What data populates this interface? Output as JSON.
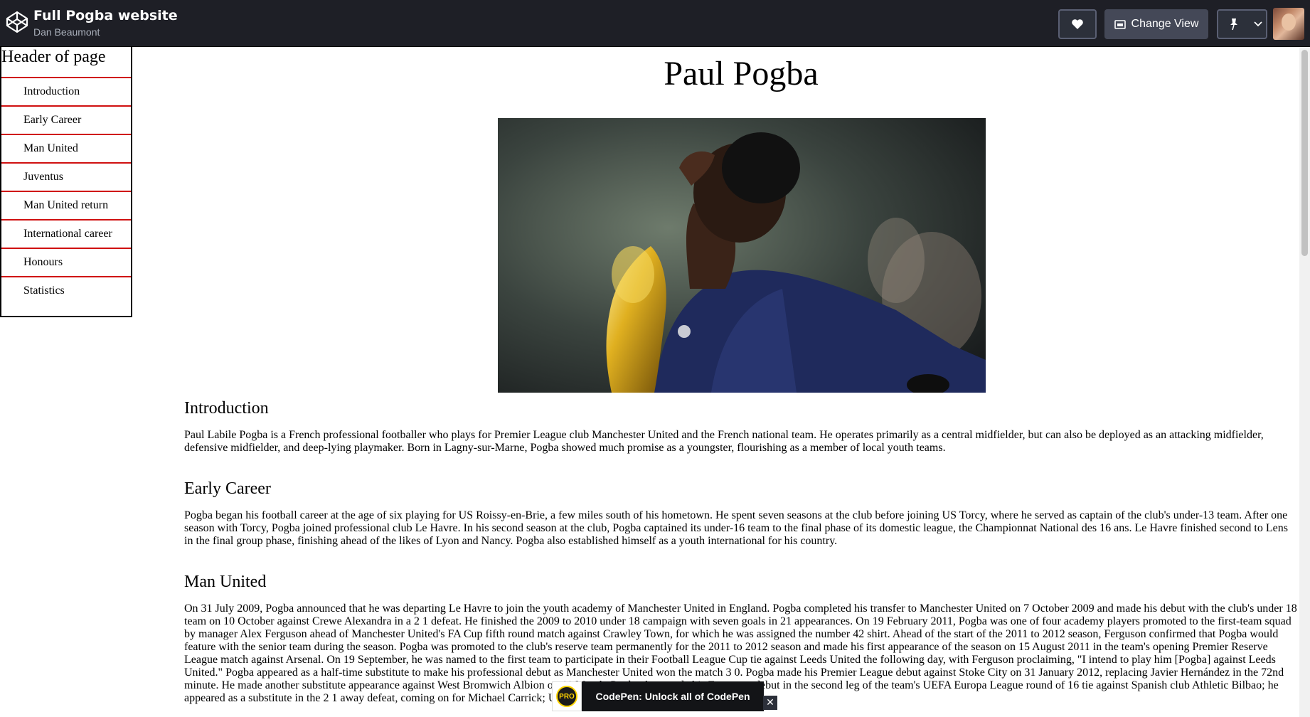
{
  "topbar": {
    "pen_title": "Full Pogba website",
    "author": "Dan Beaumont",
    "change_view_label": "Change View",
    "bg_color": "#1e1f26"
  },
  "nav": {
    "header": "Header of page",
    "items": [
      {
        "label": "Introduction"
      },
      {
        "label": "Early Career"
      },
      {
        "label": "Man United"
      },
      {
        "label": "Juventus"
      },
      {
        "label": "Man United return"
      },
      {
        "label": "International career"
      },
      {
        "label": "Honours"
      },
      {
        "label": "Statistics"
      }
    ],
    "divider_color": "#d01010"
  },
  "main": {
    "title": "Paul Pogba",
    "sections": [
      {
        "heading": "Introduction",
        "body": "Paul Labile Pogba is a French professional footballer who plays for Premier League club Manchester United and the French national team. He operates primarily as a central midfielder, but can also be deployed as an attacking midfielder, defensive midfielder, and deep-lying playmaker. Born in Lagny-sur-Marne, Pogba showed much promise as a youngster, flourishing as a member of local youth teams."
      },
      {
        "heading": "Early Career",
        "body": "Pogba began his football career at the age of six playing for US Roissy-en-Brie, a few miles south of his hometown. He spent seven seasons at the club before joining US Torcy, where he served as captain of the club's under-13 team. After one season with Torcy, Pogba joined professional club Le Havre. In his second season at the club, Pogba captained its under-16 team to the final phase of its domestic league, the Championnat National des 16 ans. Le Havre finished second to Lens in the final group phase, finishing ahead of the likes of Lyon and Nancy. Pogba also established himself as a youth international for his country."
      },
      {
        "heading": "Man United",
        "body": "On 31 July 2009, Pogba announced that he was departing Le Havre to join the youth academy of Manchester United in England. Pogba completed his transfer to Manchester United on 7 October 2009 and made his debut with the club's under 18 team on 10 October against Crewe Alexandra in a 2 1 defeat. He finished the 2009 to 2010 under 18 campaign with seven goals in 21 appearances. On 19 February 2011, Pogba was one of four academy players promoted to the first-team squad by manager Alex Ferguson ahead of Manchester United's FA Cup fifth round match against Crawley Town, for which he was assigned the number 42 shirt. Ahead of the start of the 2011 to 2012 season, Ferguson confirmed that Pogba would feature with the senior team during the season. Pogba was promoted to the club's reserve team permanently for the 2011 to 2012 season and made his first appearance of the season on 15 August 2011 in the team's opening Premier Reserve League match against Arsenal. On 19 September, he was named to the first team to participate in their Football League Cup tie against Leeds United the following day, with Ferguson proclaiming, \"I intend to play him [Pogba] against Leeds United.\" Pogba appeared as a half-time substitute to make his professional debut as Manchester United won the match 3 0. Pogba made his Premier League debut against Stoke City on 31 January 2012, replacing Javier Hernández in the 72nd minute. He made another substitute appearance against West Bromwich Albion on 11 March. Pogba then made his European debut in the second leg of the team's UEFA Europa League round of 16 tie against Spanish club Athletic Bilbao; he appeared as a substitute in the 2 1 away defeat, coming on for Michael Carrick; United lost the tie 5 3 on aggregate."
      }
    ]
  },
  "toast": {
    "badge": "PRO",
    "text": "CodePen: Unlock all of CodePen",
    "close": "✕"
  }
}
